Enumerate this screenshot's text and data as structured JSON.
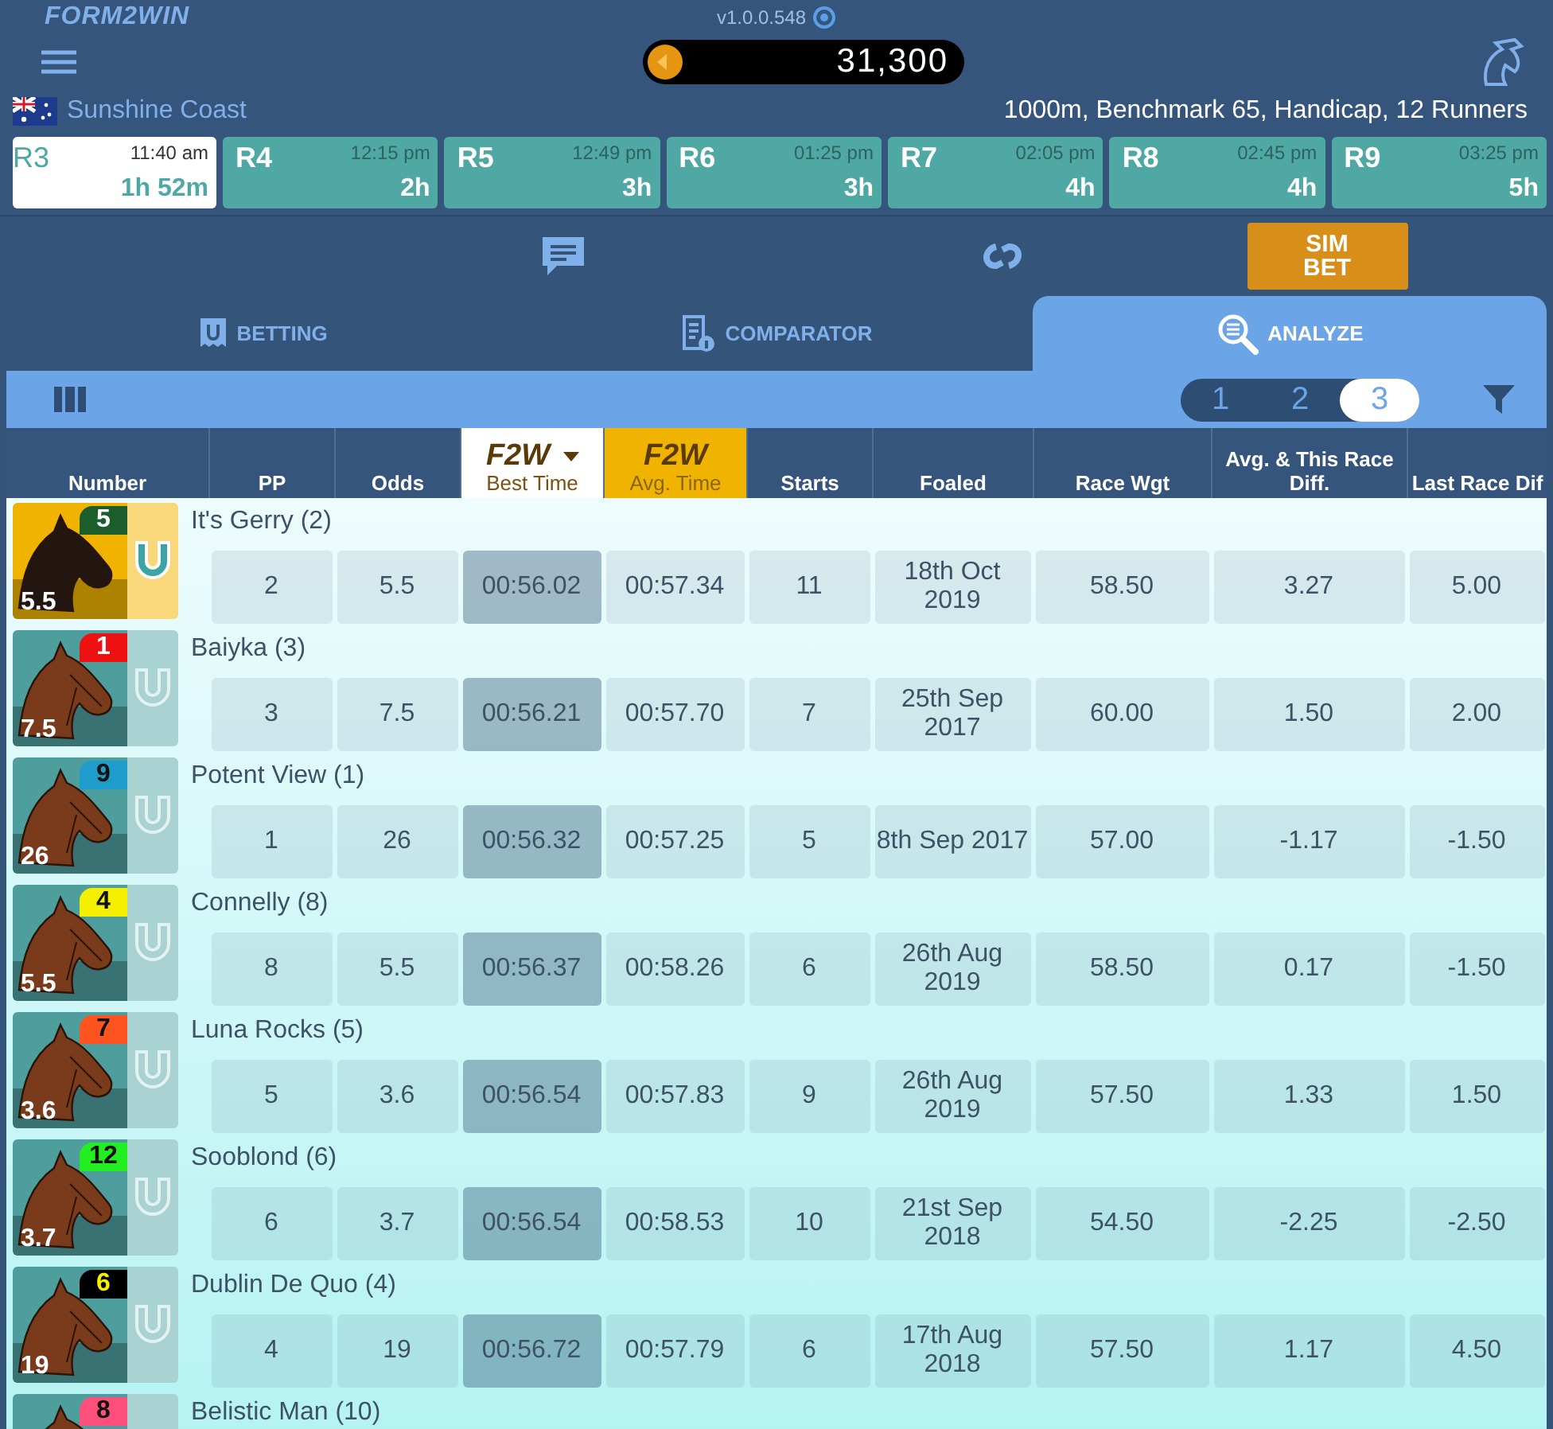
{
  "app": {
    "logo": "FORM2WIN",
    "version": "v1.0.0.548",
    "balance": "31,300"
  },
  "meeting": {
    "venue": "Sunshine Coast",
    "race_info": "1000m, Benchmark 65, Handicap, 12 Runners"
  },
  "races": [
    {
      "label": "R3",
      "time": "11:40 am",
      "countdown": "1h 52m",
      "selected": true
    },
    {
      "label": "R4",
      "time": "12:15 pm",
      "countdown": "2h",
      "selected": false
    },
    {
      "label": "R5",
      "time": "12:49 pm",
      "countdown": "3h",
      "selected": false
    },
    {
      "label": "R6",
      "time": "01:25 pm",
      "countdown": "3h",
      "selected": false
    },
    {
      "label": "R7",
      "time": "02:05 pm",
      "countdown": "4h",
      "selected": false
    },
    {
      "label": "R8",
      "time": "02:45 pm",
      "countdown": "4h",
      "selected": false
    },
    {
      "label": "R9",
      "time": "03:25 pm",
      "countdown": "5h",
      "selected": false
    }
  ],
  "sim_bet": "SIM BET",
  "tabs": [
    {
      "label": "BETTING",
      "selected": false
    },
    {
      "label": "COMPARATOR",
      "selected": false
    },
    {
      "label": "ANALYZE",
      "selected": true
    }
  ],
  "pages": [
    {
      "label": "1",
      "selected": false
    },
    {
      "label": "2",
      "selected": false
    },
    {
      "label": "3",
      "selected": true
    }
  ],
  "columns": [
    {
      "kind": "plain",
      "label": "Number"
    },
    {
      "kind": "plain",
      "label": "PP"
    },
    {
      "kind": "plain",
      "label": "Odds"
    },
    {
      "kind": "brand",
      "brand": "F2W",
      "label": "Best Time",
      "selected": true
    },
    {
      "kind": "brand",
      "brand": "F2W",
      "label": "Avg. Time",
      "selected": false
    },
    {
      "kind": "plain",
      "label": "Starts"
    },
    {
      "kind": "plain",
      "label": "Foaled"
    },
    {
      "kind": "plain",
      "label": "Race Wgt"
    },
    {
      "kind": "plain",
      "label": "Avg. & This Race Diff."
    },
    {
      "kind": "plain",
      "label": "Last Race Dif"
    }
  ],
  "rows": [
    {
      "name": "It's Gerry (2)",
      "number": "5",
      "color": "#1b5e2c",
      "odds": "5.5",
      "selected": true,
      "shortlisted": true,
      "cells": [
        "2",
        "5.5",
        "00:56.02",
        "00:57.34",
        "11",
        "18th Oct 2019",
        "58.50",
        "3.27",
        "5.00"
      ]
    },
    {
      "name": "Baiyka (3)",
      "number": "1",
      "color": "#ee1111",
      "odds": "7.5",
      "selected": false,
      "shortlisted": false,
      "cells": [
        "3",
        "7.5",
        "00:56.21",
        "00:57.70",
        "7",
        "25th Sep 2017",
        "60.00",
        "1.50",
        "2.00"
      ]
    },
    {
      "name": "Potent View (1)",
      "number": "9",
      "color": "#1e9ccc",
      "odds": "26",
      "selected": false,
      "shortlisted": false,
      "cells": [
        "1",
        "26",
        "00:56.32",
        "00:57.25",
        "5",
        "8th Sep 2017",
        "57.00",
        "-1.17",
        "-1.50"
      ]
    },
    {
      "name": "Connelly (8)",
      "number": "4",
      "color": "#f5f000",
      "odds": "5.5",
      "selected": false,
      "shortlisted": false,
      "cells": [
        "8",
        "5.5",
        "00:56.37",
        "00:58.26",
        "6",
        "26th Aug 2019",
        "58.50",
        "0.17",
        "-1.50"
      ]
    },
    {
      "name": "Luna Rocks (5)",
      "number": "7",
      "color": "#ff5420",
      "odds": "3.6",
      "selected": false,
      "shortlisted": false,
      "cells": [
        "5",
        "3.6",
        "00:56.54",
        "00:57.83",
        "9",
        "26th Aug 2019",
        "57.50",
        "1.33",
        "1.50"
      ]
    },
    {
      "name": "Sooblond (6)",
      "number": "12",
      "color": "#22ee22",
      "odds": "3.7",
      "selected": false,
      "shortlisted": false,
      "cells": [
        "6",
        "3.7",
        "00:56.54",
        "00:58.53",
        "10",
        "21st Sep 2018",
        "54.50",
        "-2.25",
        "-2.50"
      ]
    },
    {
      "name": "Dublin De Quo (4)",
      "number": "6",
      "color": "#000000",
      "odds": "19",
      "selected": false,
      "shortlisted": false,
      "cells": [
        "4",
        "19",
        "00:56.72",
        "00:57.79",
        "6",
        "17th Aug 2018",
        "57.50",
        "1.17",
        "4.50"
      ]
    },
    {
      "name": "Belistic Man (10)",
      "number": "8",
      "color": "#ff4f7b",
      "selected": false
    }
  ]
}
